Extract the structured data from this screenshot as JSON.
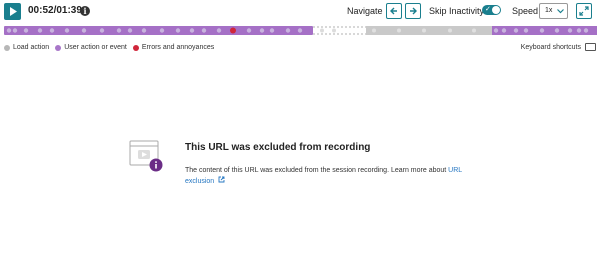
{
  "player": {
    "time": "00:52/01:39",
    "navigate_label": "Navigate",
    "skip_label": "Skip Inactivity",
    "skip_enabled": true,
    "speed_label": "Speed",
    "speed_value": "1x",
    "progress": 0.52
  },
  "legend": {
    "items": [
      {
        "label": "Load action",
        "color": "#b7b7b7"
      },
      {
        "label": "User action or event",
        "color": "#a877c9"
      },
      {
        "label": "Errors and annoyances",
        "color": "#d0263a"
      }
    ],
    "keyboard_shortcuts": "Keyboard shortcuts"
  },
  "message": {
    "title": "This URL was excluded from recording",
    "body": "The content of this URL was excluded from the session recording. Learn more about",
    "link1": "URL",
    "link2": "exclusion"
  },
  "colors": {
    "accent": "#1a7f8e",
    "played": "#a570c6",
    "unplayed": "#c9c9c9",
    "error": "#d0263a",
    "link": "#2677c2"
  }
}
